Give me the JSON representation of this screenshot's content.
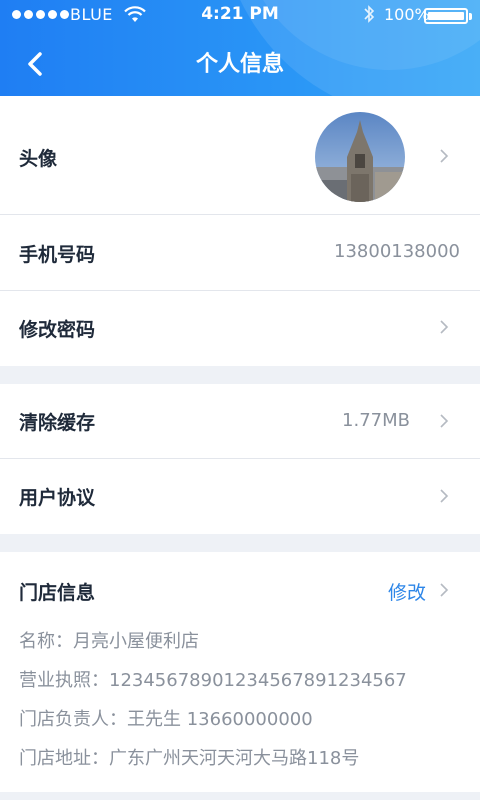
{
  "status_bar": {
    "carrier": "BLUE",
    "time": "4:21 PM",
    "battery": "100%"
  },
  "nav": {
    "title": "个人信息"
  },
  "profile": {
    "avatar_label": "头像",
    "phone_label": "手机号码",
    "phone_value": "13800138000",
    "password_label": "修改密码"
  },
  "settings": {
    "clear_cache_label": "清除缓存",
    "cache_size": "1.77MB",
    "agreement_label": "用户协议"
  },
  "store": {
    "title": "门店信息",
    "edit_label": "修改",
    "name_line": "名称：月亮小屋便利店",
    "license_line": "营业执照：12345678901234567891234567",
    "manager_line": "门店负责人：王先生  13660000000",
    "address_line": "门店地址：广东广州天河天河大马路118号"
  },
  "colors": {
    "header_start": "#1f7ef3",
    "header_end": "#35a6f7",
    "link": "#2d86e8",
    "background": "#eef1f6"
  }
}
